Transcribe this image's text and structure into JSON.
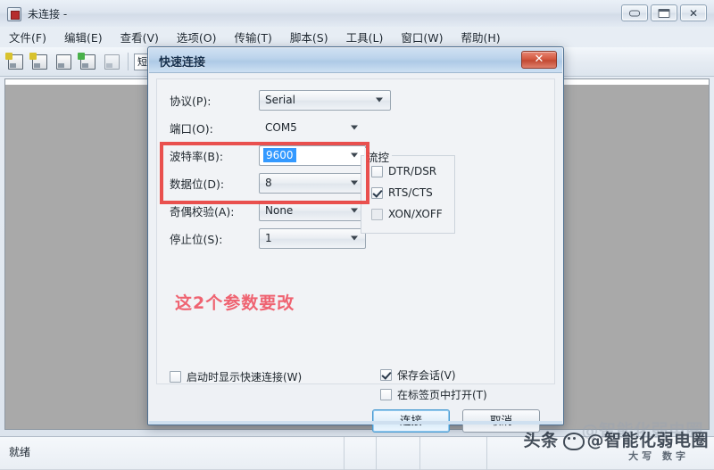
{
  "app": {
    "title": "未连接 -",
    "icon": "terminal-app-icon",
    "window_buttons": [
      {
        "name": "minimize",
        "glyph": "minimize-icon"
      },
      {
        "name": "maximize",
        "glyph": "maximize-icon"
      },
      {
        "name": "close",
        "glyph": "✕"
      }
    ]
  },
  "menubar": {
    "items": [
      {
        "label": "文件(F)",
        "name": "file"
      },
      {
        "label": "编辑(E)",
        "name": "edit"
      },
      {
        "label": "查看(V)",
        "name": "view"
      },
      {
        "label": "选项(O)",
        "name": "options"
      },
      {
        "label": "传输(T)",
        "name": "transfer"
      },
      {
        "label": "脚本(S)",
        "name": "script"
      },
      {
        "label": "工具(L)",
        "name": "tools"
      },
      {
        "label": "窗口(W)",
        "name": "window"
      },
      {
        "label": "帮助(H)",
        "name": "help"
      }
    ]
  },
  "toolbar": {
    "icons": [
      {
        "name": "new-session-icon",
        "badge": "#d8c22e"
      },
      {
        "name": "connect-icon",
        "badge": "#d8c22e"
      },
      {
        "name": "open-folder-icon",
        "badge": "none"
      },
      {
        "name": "quick-connect-icon",
        "badge": "#49b04a"
      },
      {
        "name": "disconnect-icon",
        "badge": "none"
      }
    ],
    "combo_value": "短"
  },
  "dialog": {
    "title": "快速连接",
    "close_label": "✕",
    "fields": [
      {
        "name": "protocol",
        "label": "协议(P):",
        "value": "Serial",
        "editable": false,
        "wide": true
      },
      {
        "name": "port",
        "label": "端口(O):",
        "value": "COM5",
        "editable": false,
        "wide": false
      },
      {
        "name": "baud-rate",
        "label": "波特率(B):",
        "value": "9600",
        "editable": true,
        "wide": false
      },
      {
        "name": "data-bits",
        "label": "数据位(D):",
        "value": "8",
        "editable": false,
        "wide": false
      },
      {
        "name": "parity",
        "label": "奇偶校验(A):",
        "value": "None",
        "editable": false,
        "wide": false
      },
      {
        "name": "stop-bits",
        "label": "停止位(S):",
        "value": "1",
        "editable": false,
        "wide": false
      }
    ],
    "flow_control": {
      "legend": "流控",
      "options": [
        {
          "name": "dtr-dsr",
          "label": "DTR/DSR",
          "checked": false
        },
        {
          "name": "rts-cts",
          "label": "RTS/CTS",
          "checked": true
        },
        {
          "name": "xon-xoff",
          "label": "XON/XOFF",
          "checked": false
        }
      ]
    },
    "annotation": "这2个参数要改",
    "bottom_options": [
      {
        "name": "show-on-startup",
        "label": "启动时显示快速连接(W)",
        "checked": false
      },
      {
        "name": "save-session",
        "label": "保存会话(V)",
        "checked": true
      },
      {
        "name": "open-in-tab",
        "label": "在标签页中打开(T)",
        "checked": false
      }
    ],
    "buttons": [
      {
        "name": "connect",
        "label": "连接",
        "default": true
      },
      {
        "name": "cancel",
        "label": "取消",
        "default": false
      }
    ]
  },
  "statusbar": {
    "ready": "就绪"
  },
  "watermark": {
    "text": "头条 @智能化弱电圈",
    "prefix": "头条",
    "handle": "@智能化弱电圈",
    "sub": "大写 数字"
  },
  "colors": {
    "accent_red": "#e8423f",
    "annotation_red": "#ef4a5a",
    "selection_blue": "#3399ff",
    "dialog_title_blue": "#aecae6",
    "terminal_gray": "#a9a9a9"
  }
}
